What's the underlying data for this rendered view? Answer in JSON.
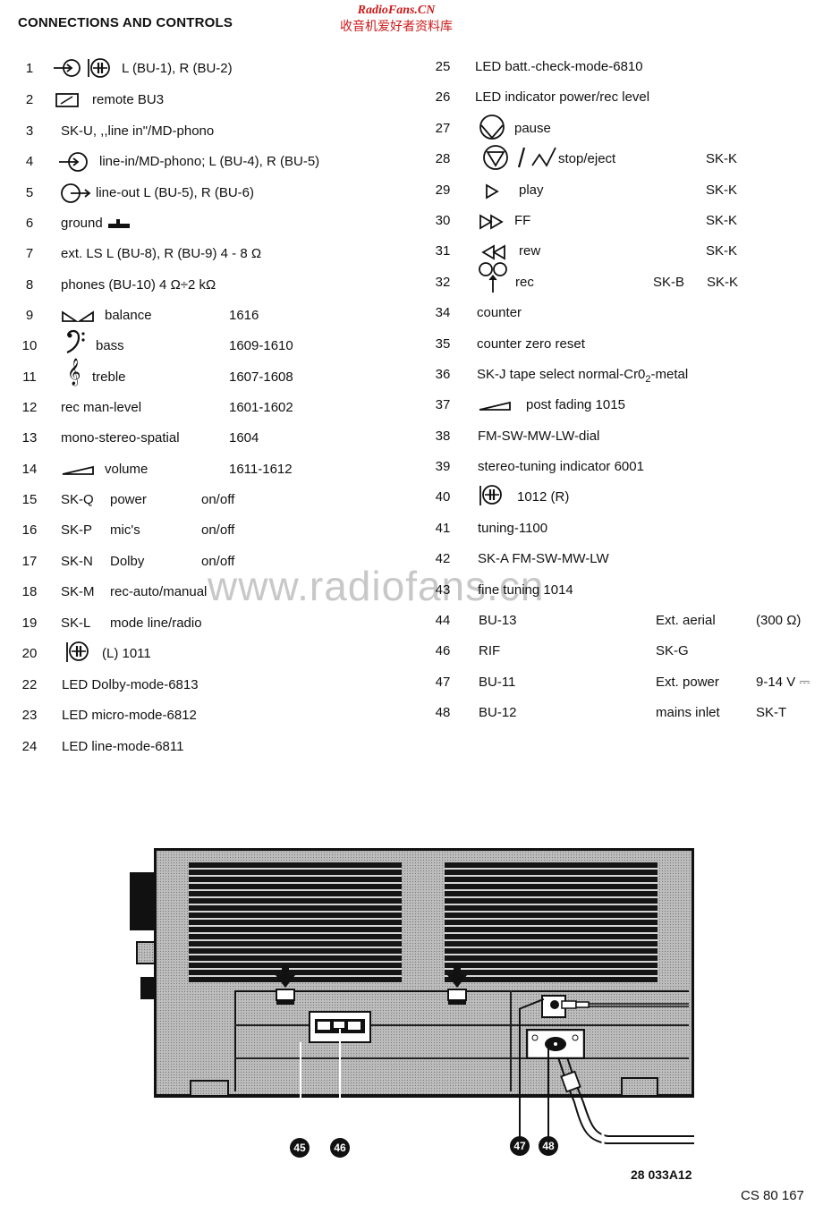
{
  "header": {
    "title": "CONNECTIONS AND CONTROLS",
    "watermark_en": "RadioFans.CN",
    "watermark_cn": "收音机爱好者资料库",
    "watermark_url": "www.radiofans.cn"
  },
  "left_items": [
    {
      "num": "1",
      "icon": "input-jack-and-capacitor-icon",
      "label": "L (BU-1), R (BU-2)",
      "ref": ""
    },
    {
      "num": "2",
      "icon": "remote-switch-icon",
      "label": "remote BU3",
      "ref": ""
    },
    {
      "num": "3",
      "icon": "",
      "label": "SK-U, ,,line in\"/MD-phono",
      "ref": ""
    },
    {
      "num": "4",
      "icon": "input-jack-icon",
      "label": "line-in/MD-phono; L (BU-4), R (BU-5)",
      "ref": ""
    },
    {
      "num": "5",
      "icon": "output-jack-icon",
      "label": "line-out L (BU-5), R (BU-6)",
      "ref": ""
    },
    {
      "num": "6",
      "icon": "",
      "label": "ground",
      "ref": ""
    },
    {
      "num": "7",
      "icon": "",
      "label": "ext. LS L (BU-8), R (BU-9) 4 - 8 Ω",
      "ref": ""
    },
    {
      "num": "8",
      "icon": "",
      "label": "phones (BU-10) 4 Ω÷2 kΩ",
      "ref": ""
    },
    {
      "num": "9",
      "icon": "balance-icon",
      "label": "balance",
      "ref": "1616"
    },
    {
      "num": "10",
      "icon": "bass-clef-icon",
      "label": "bass",
      "ref": "1609-1610"
    },
    {
      "num": "11",
      "icon": "treble-clef-icon",
      "label": "treble",
      "ref": "1607-1608"
    },
    {
      "num": "12",
      "icon": "",
      "label": "rec man-level",
      "ref": "1601-1602"
    },
    {
      "num": "13",
      "icon": "",
      "label": "mono-stereo-spatial",
      "ref": "1604"
    },
    {
      "num": "14",
      "icon": "volume-wedge-icon",
      "label": "volume",
      "ref": "1611-1612"
    },
    {
      "num": "15",
      "icon": "",
      "code": "SK-Q",
      "label": "power",
      "ref": "on/off"
    },
    {
      "num": "16",
      "icon": "",
      "code": "SK-P",
      "label": "mic's",
      "ref": "on/off"
    },
    {
      "num": "17",
      "icon": "",
      "code": "SK-N",
      "label": "Dolby",
      "ref": "on/off"
    },
    {
      "num": "18",
      "icon": "",
      "code": "SK-M",
      "label": "rec-auto/manual",
      "ref": ""
    },
    {
      "num": "19",
      "icon": "",
      "code": "SK-L",
      "label": "mode line/radio",
      "ref": ""
    },
    {
      "num": "20",
      "icon": "capacitor-knob-icon",
      "label": "(L) 1011",
      "ref": ""
    },
    {
      "num": "22",
      "icon": "",
      "label": "LED Dolby-mode-6813",
      "ref": ""
    },
    {
      "num": "23",
      "icon": "",
      "label": "LED micro-mode-6812",
      "ref": ""
    },
    {
      "num": "24",
      "icon": "",
      "label": "LED line-mode-6811",
      "ref": ""
    }
  ],
  "right_items": [
    {
      "num": "25",
      "icon": "",
      "label": "LED batt.-check-mode-6810",
      "col2": "",
      "col3": ""
    },
    {
      "num": "26",
      "icon": "",
      "label": "LED indicator power/rec level",
      "col2": "",
      "col3": ""
    },
    {
      "num": "27",
      "icon": "pause-icon",
      "label": "pause",
      "col2": "",
      "col3": ""
    },
    {
      "num": "28",
      "icon": "stop-eject-icon",
      "label": "stop/eject",
      "col2": "",
      "col3": "SK-K"
    },
    {
      "num": "29",
      "icon": "play-icon",
      "label": "play",
      "col2": "",
      "col3": "SK-K"
    },
    {
      "num": "30",
      "icon": "fast-forward-icon",
      "label": "FF",
      "col2": "",
      "col3": "SK-K"
    },
    {
      "num": "31",
      "icon": "rewind-icon",
      "label": "rew",
      "col2": "",
      "col3": "SK-K"
    },
    {
      "num": "32",
      "icon": "record-icon",
      "label": "rec",
      "col2": "SK-B",
      "col3": "SK-K"
    },
    {
      "num": "34",
      "icon": "",
      "label": "counter",
      "col2": "",
      "col3": ""
    },
    {
      "num": "35",
      "icon": "",
      "label": "counter zero reset",
      "col2": "",
      "col3": ""
    },
    {
      "num": "36",
      "icon": "",
      "label": "SK-J tape select normal-Cr0",
      "label_sub": "2",
      "label_tail": "-metal",
      "col2": "",
      "col3": ""
    },
    {
      "num": "37",
      "icon": "volume-wedge-icon",
      "label": "post fading 1015",
      "col2": "",
      "col3": ""
    },
    {
      "num": "38",
      "icon": "",
      "label": "FM-SW-MW-LW-dial",
      "col2": "",
      "col3": ""
    },
    {
      "num": "39",
      "icon": "",
      "label": "stereo-tuning indicator 6001",
      "col2": "",
      "col3": ""
    },
    {
      "num": "40",
      "icon": "capacitor-knob-icon",
      "label": "1012 (R)",
      "col2": "",
      "col3": ""
    },
    {
      "num": "41",
      "icon": "",
      "label": "tuning-1100",
      "col2": "",
      "col3": ""
    },
    {
      "num": "42",
      "icon": "",
      "label": "SK-A FM-SW-MW-LW",
      "col2": "",
      "col3": ""
    },
    {
      "num": "43",
      "icon": "",
      "label": "fine tuning 1014",
      "col2": "",
      "col3": ""
    },
    {
      "num": "44",
      "icon": "",
      "label": "BU-13",
      "col2": "Ext. aerial",
      "col3": "(300 Ω)"
    },
    {
      "num": "46",
      "icon": "",
      "label": "RIF",
      "col2": "SK-G",
      "col3": ""
    },
    {
      "num": "47",
      "icon": "",
      "label": "BU-11",
      "col2": "Ext. power",
      "col3": "9-14 V ⎓"
    },
    {
      "num": "48",
      "icon": "",
      "label": "BU-12",
      "col2": "mains inlet",
      "col3": "SK-T"
    }
  ],
  "diagram": {
    "callouts": [
      "45",
      "46",
      "47",
      "48"
    ],
    "figure_code": "28 033A12",
    "doc_code": "CS 80 167"
  }
}
